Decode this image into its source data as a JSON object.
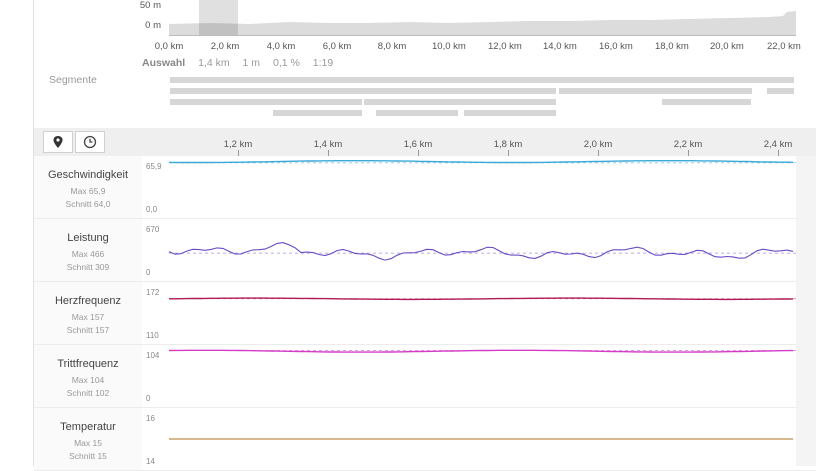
{
  "elevation": {
    "y_labels": [
      "50 m",
      "0 m"
    ],
    "x_ticks": [
      "0,0 km",
      "2,0 km",
      "4,0 km",
      "6,0 km",
      "8,0 km",
      "10,0 km",
      "12,0 km",
      "14,0 km",
      "16,0 km",
      "18,0 km",
      "20,0 km",
      "22,0 km"
    ]
  },
  "selection": {
    "label": "Auswahl",
    "distance": "1,4 km",
    "climb": "1 m",
    "grade": "0,1 %",
    "time": "1:19"
  },
  "segments_label": "Segmente",
  "detail_x_ticks": [
    "1,2 km",
    "1,4 km",
    "1,6 km",
    "1,8 km",
    "2,0 km",
    "2,2 km",
    "2,4 km"
  ],
  "metrics": [
    {
      "name": "Geschwindigkeit",
      "max": "Max 65,9",
      "avg": "Schnitt 64,0",
      "ymax": "65,9",
      "ymin": "0,0",
      "color": "#3aa9d8"
    },
    {
      "name": "Leistung",
      "max": "Max 466",
      "avg": "Schnitt 309",
      "ymax": "670",
      "ymin": "0",
      "color": "#6a4bc4"
    },
    {
      "name": "Herzfrequenz",
      "max": "Max 157",
      "avg": "Schnitt 157",
      "ymax": "172",
      "ymin": "110",
      "color": "#b01a55"
    },
    {
      "name": "Trittfrequenz",
      "max": "Max 104",
      "avg": "Schnitt 102",
      "ymax": "104",
      "ymin": "0",
      "color": "#d43cc8"
    },
    {
      "name": "Temperatur",
      "max": "Max 15",
      "avg": "Schnitt 15",
      "ymax": "16",
      "ymin": "14",
      "color": "#c9a26a"
    }
  ],
  "icons": {
    "map": "map-pin-icon",
    "time": "clock-icon"
  }
}
